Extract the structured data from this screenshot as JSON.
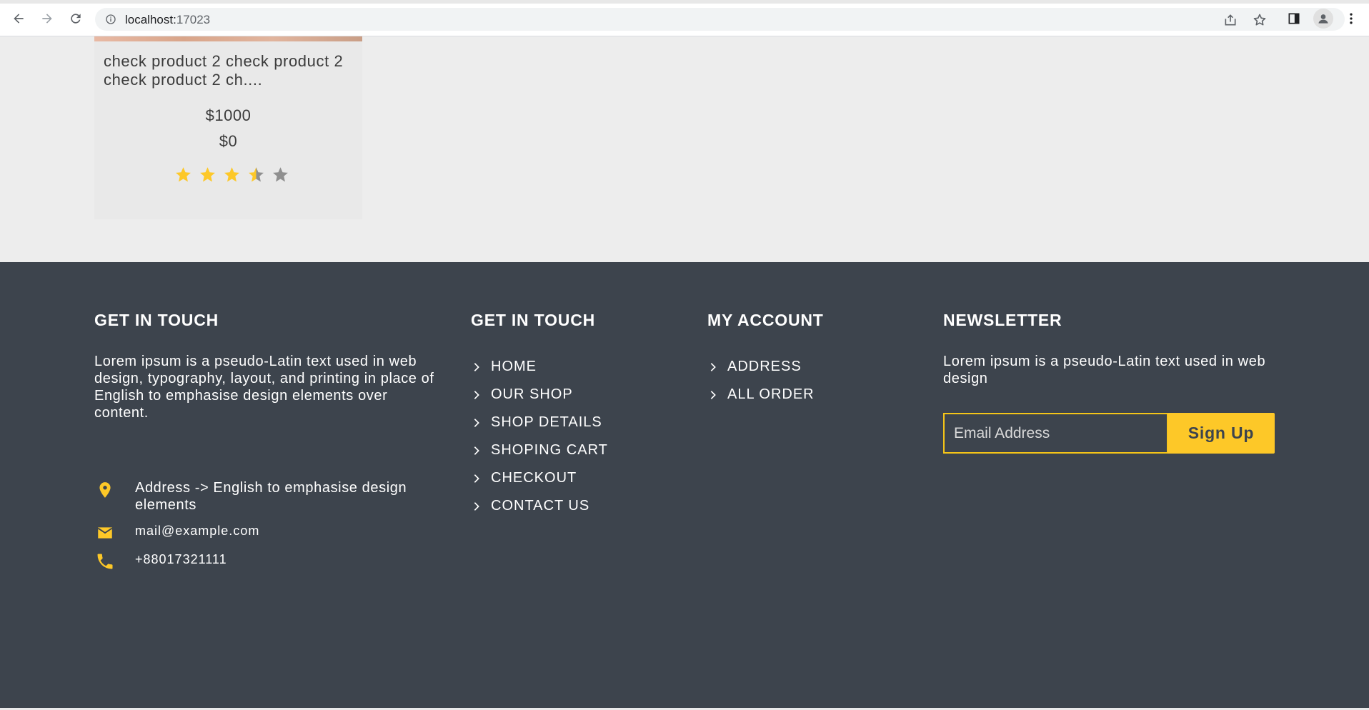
{
  "browser": {
    "url_host": "localhost:",
    "url_port": "17023"
  },
  "product": {
    "title": "check product 2 check product 2 check product 2 ch....",
    "price": "$1000",
    "discount_price": "$0",
    "rating": 3.5,
    "rating_max": 5,
    "star_color": "#fdc828"
  },
  "footer": {
    "col1": {
      "title": "GET IN TOUCH",
      "text": "Lorem ipsum is a pseudo-Latin text used in web design, typography, layout, and printing in place of English to emphasise design elements over content.",
      "address": "Address -> English to emphasise design elements",
      "email": "mail@example.com",
      "phone": "+88017321111"
    },
    "col2": {
      "title": "GET IN TOUCH",
      "links": [
        "HOME",
        "OUR SHOP",
        "SHOP DETAILS",
        "SHOPING CART",
        "CHECKOUT",
        "CONTACT US"
      ]
    },
    "col3": {
      "title": "MY ACCOUNT",
      "links": [
        "ADDRESS",
        "ALL ORDER"
      ]
    },
    "col4": {
      "title": "NEWSLETTER",
      "text": "Lorem ipsum is a pseudo-Latin text used in web design",
      "email_placeholder": "Email Address",
      "signup_label": "Sign Up"
    },
    "colors": {
      "background": "#3d444d",
      "accent": "#fdc828"
    }
  }
}
